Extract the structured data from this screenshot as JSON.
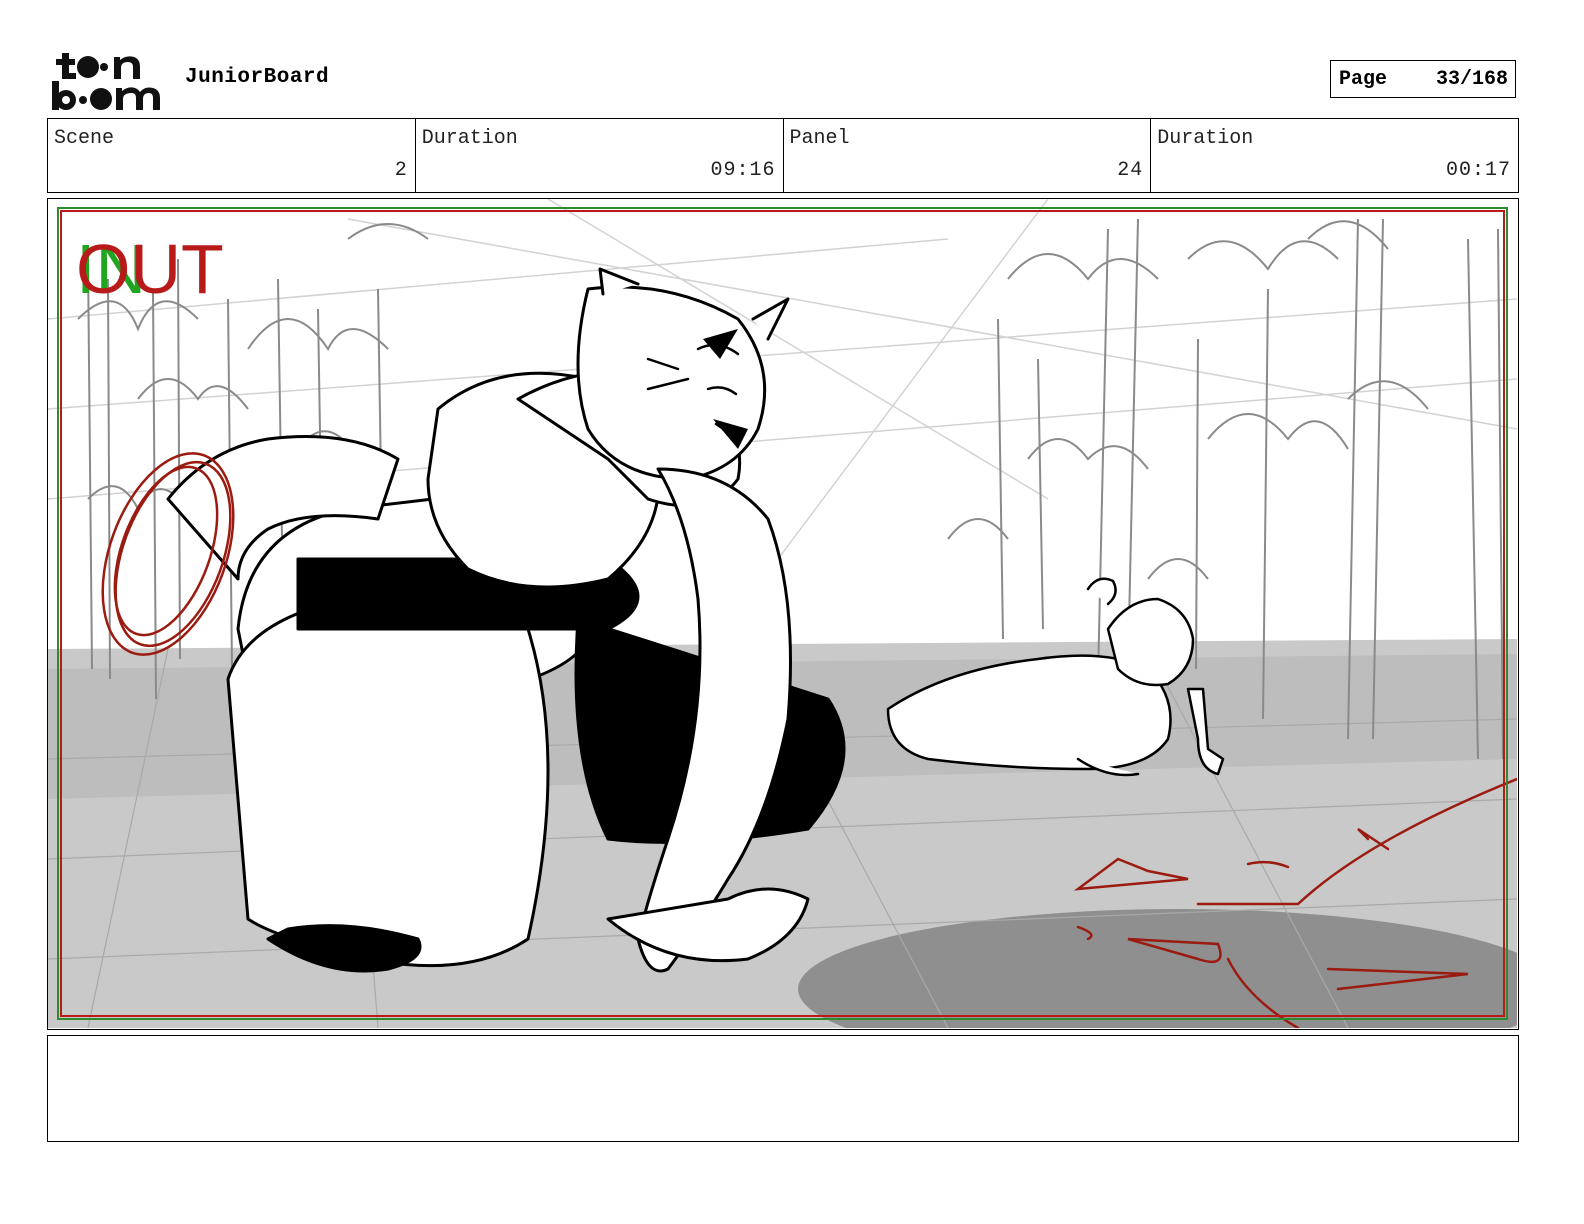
{
  "header": {
    "logo": {
      "icon": "toonboom-logo",
      "text_top": "toon",
      "text_bottom": "boom"
    },
    "app_name": "JuniorBoard",
    "page_label": "Page",
    "page_value": "33/168"
  },
  "info": {
    "scene_label": "Scene",
    "scene_value": "2",
    "scene_duration_label": "Duration",
    "scene_duration_value": "09:16",
    "panel_label": "Panel",
    "panel_value": "24",
    "panel_duration_label": "Duration",
    "panel_duration_value": "00:17"
  },
  "panel": {
    "in_marker": "IN",
    "out_marker": "OUT",
    "colors": {
      "in": "#1fa51f",
      "out": "#b81a1a",
      "safe_frame_green": "#2e8b2e",
      "safe_frame_red": "#b81a1a",
      "fx_red": "#9b1b10"
    }
  },
  "notes": {
    "text": ""
  }
}
